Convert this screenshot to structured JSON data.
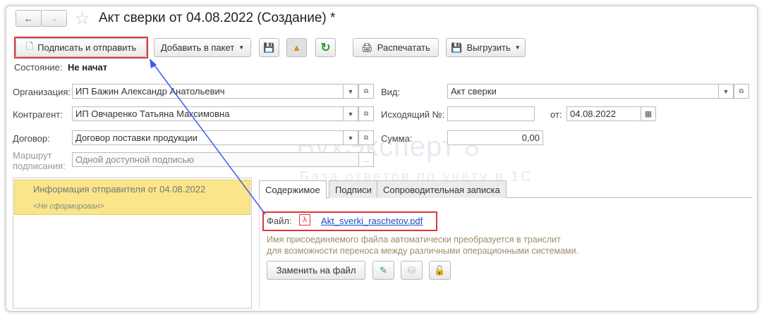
{
  "title": "Акт сверки от 04.08.2022 (Создание) *",
  "toolbar": {
    "sign_send": "Подписать и отправить",
    "add_package": "Добавить в пакет",
    "print": "Распечатать",
    "export": "Выгрузить"
  },
  "status": {
    "label": "Состояние:",
    "value": "Не начат"
  },
  "form": {
    "org_label": "Организация:",
    "org_value": "ИП Бажин Александр Анатольевич",
    "contractor_label": "Контрагент:",
    "contractor_value": "ИП Овчаренко Татьяна Максимовна",
    "contract_label": "Договор:",
    "contract_value": "Договор поставки продукции",
    "route_label_1": "Маршрут",
    "route_label_2": "подписания:",
    "route_value": "Одной доступной подписью",
    "route_more": "...",
    "kind_label": "Вид:",
    "kind_value": "Акт сверки",
    "outgoing_label": "Исходящий №:",
    "outgoing_value": "",
    "from_label": "от:",
    "date_value": "04.08.2022",
    "sum_label": "Сумма:",
    "sum_value": "0,00"
  },
  "left_panel": {
    "item_title": "Информация отправителя от 04.08.2022",
    "item_status": "<Не сформирован>"
  },
  "tabs": [
    "Содержимое",
    "Подписи",
    "Сопроводительная записка"
  ],
  "content": {
    "file_label": "Файл:",
    "file_name": "Akt_sverki_raschetov.pdf",
    "note_1": "Имя присоединяемого файла автоматически преобразуется в транслит",
    "note_2": "для возможности переноса между различными операционными системами.",
    "replace_button": "Заменить на файл"
  },
  "watermark": {
    "brand": "БухЭксперт 8",
    "tagline": "База ответов по учёту в 1С"
  },
  "colors": {
    "highlight": "#e0353b",
    "arrow": "#3a5af0",
    "selected_item": "#fbe58a",
    "link": "#1a4fc4"
  }
}
